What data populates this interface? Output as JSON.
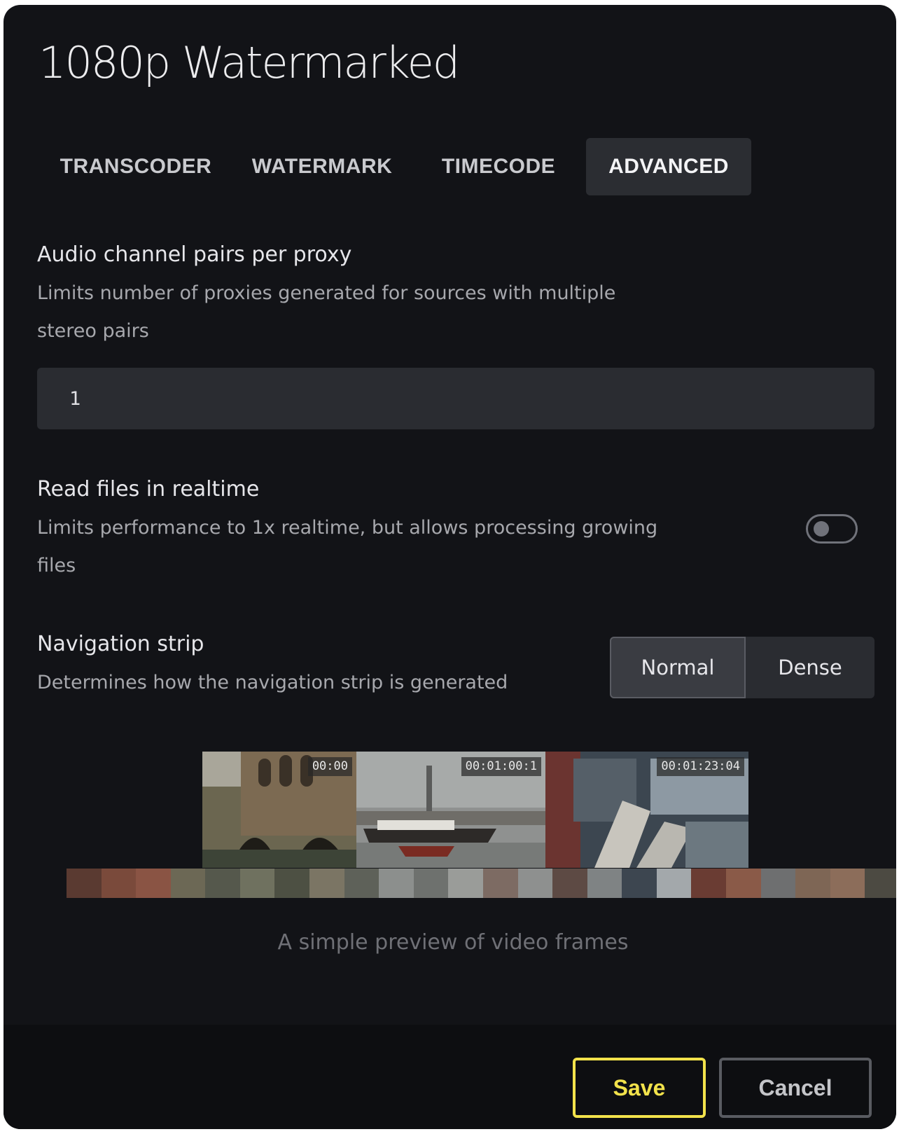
{
  "dialog": {
    "title": "1080p Watermarked"
  },
  "tabs": [
    {
      "label": "TRANSCODER",
      "active": false
    },
    {
      "label": "WATERMARK",
      "active": false
    },
    {
      "label": "TIMECODE",
      "active": false
    },
    {
      "label": "ADVANCED",
      "active": true
    }
  ],
  "audio_pairs": {
    "label": "Audio channel pairs per proxy",
    "description_line1": "Limits number of proxies generated for sources with multiple",
    "description_line2": "stereo pairs",
    "value": "1"
  },
  "realtime": {
    "label": "Read files in realtime",
    "description_line1": "Limits performance to 1x realtime, but allows processing growing",
    "description_line2": "files",
    "enabled": false
  },
  "nav_strip": {
    "label": "Navigation strip",
    "description": "Determines how the navigation strip is generated",
    "options": [
      "Normal",
      "Dense"
    ],
    "selected": "Normal"
  },
  "preview": {
    "frames": [
      {
        "timecode": "00:00",
        "icon": "video-frame-bridge"
      },
      {
        "timecode": "00:01:00:1",
        "icon": "video-frame-harbor-ship"
      },
      {
        "timecode": "00:01:23:04",
        "icon": "video-frame-ship-deck"
      }
    ],
    "caption": "A simple preview of video frames"
  },
  "footer": {
    "save_label": "Save",
    "cancel_label": "Cancel"
  },
  "colors": {
    "background": "#121317",
    "accent_save": "#f2e24b",
    "tab_active_bg": "#2b2d32"
  }
}
